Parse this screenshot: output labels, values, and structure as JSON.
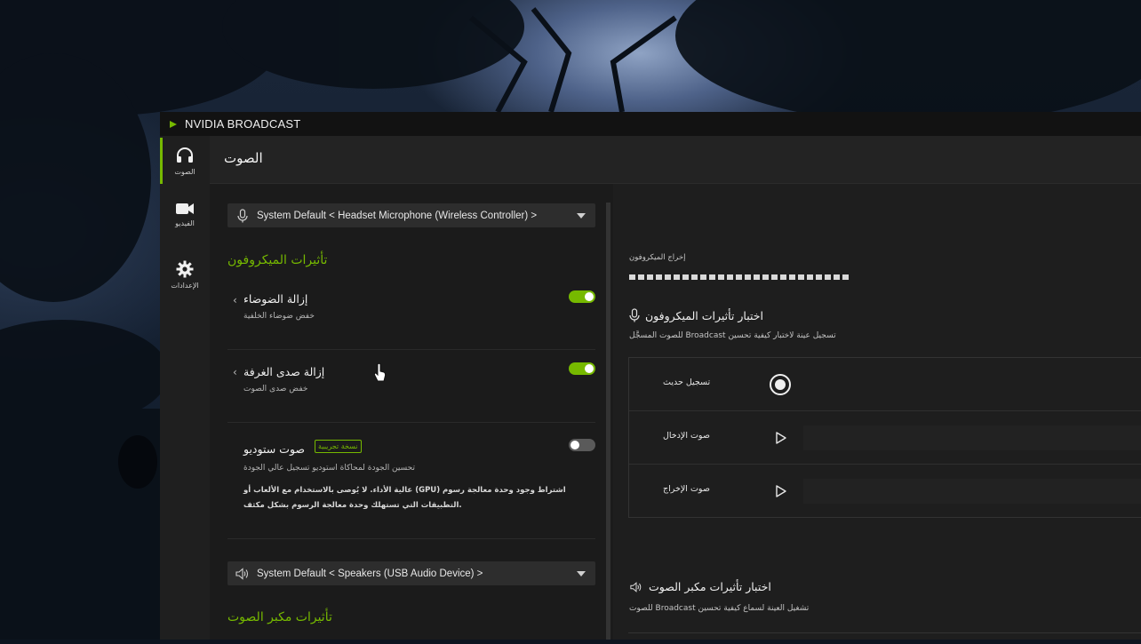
{
  "app": {
    "title": "NVIDIA BROADCAST"
  },
  "sidebar": {
    "items": [
      {
        "label": "الصوت",
        "icon": "headphones-icon",
        "active": true
      },
      {
        "label": "الفيديو",
        "icon": "video-camera-icon",
        "active": false
      },
      {
        "label": "الإعدادات",
        "icon": "gear-icon",
        "active": false
      }
    ]
  },
  "header": {
    "title": "الصوت"
  },
  "microphone": {
    "device_label": "System Default < Headset Microphone (Wireless Controller) >",
    "section_title": "تأثيرات الميكروفون",
    "effects": [
      {
        "name": "إزالة الضوضاء",
        "description": "خفض ضوضاء الخلفية",
        "enabled": true
      },
      {
        "name": "إزالة صدى الغرفة",
        "description": "خفض صدى الصوت",
        "enabled": true
      },
      {
        "name": "صوت ستوديو",
        "badge": "نسخة تجريبية",
        "description": "تحسين الجودة لمحاكاة استوديو تسجيل عالي الجودة",
        "warning_line1": "عالية الأداء. لا يُوصى بالاستخدام مع الألعاب أو (GPU) اشتراط وجود وحدة معالجة رسوم",
        "warning_line2": "التطبيقات التي تستهلك وحدة معالجة الرسوم بشكل مكثف.",
        "enabled": false
      }
    ]
  },
  "speaker": {
    "device_label": "System Default < Speakers (USB Audio Device) >",
    "section_title": "تأثيرات مكبر الصوت"
  },
  "right_panel": {
    "mic_output_label": "إخراج الميكروفون",
    "mic_level_segments": 25,
    "mic_test_title": "اختبار تأثيرات الميكروفون",
    "mic_test_subtitle": "للصوت المسجَّل Broadcast تسجيل عينة لاختبار كيفية تحسين",
    "test_rows": [
      {
        "label": "تسجيل حديث",
        "action": "record-icon"
      },
      {
        "label": "صوت الإدخال",
        "action": "play-icon"
      },
      {
        "label": "صوت الإخراج",
        "action": "play-icon"
      }
    ],
    "speaker_test_title": "اختبار تأثيرات مكبر الصوت",
    "speaker_test_subtitle": "للصوت Broadcast تشغيل العينة لسماع كيفية تحسين"
  },
  "colors": {
    "accent": "#76b900",
    "window_bg": "#1b1b1b",
    "titlebar_bg": "#121212"
  }
}
